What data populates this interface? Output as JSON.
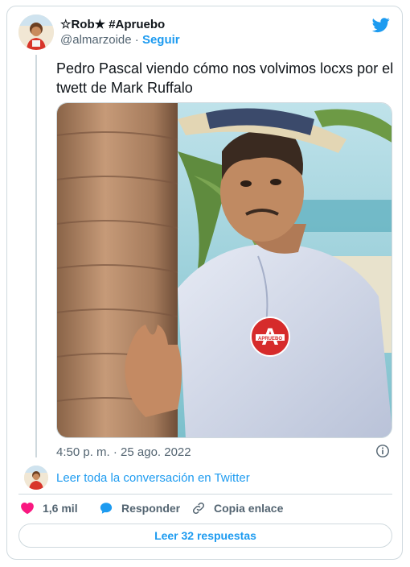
{
  "author": {
    "name": "☆Rob★ #Apruebo",
    "handle": "@almarzoide",
    "separator": "·",
    "follow_label": "Seguir"
  },
  "tweet": {
    "text": "Pedro Pascal viendo cómo nos volvimos locxs por el twett de Mark Ruffalo",
    "badge_text": "APRUEBO",
    "timestamp": "4:50 p. m. · 25 ago. 2022"
  },
  "conversation": {
    "link_label": "Leer toda la conversación en Twitter"
  },
  "actions": {
    "likes": "1,6 mil",
    "reply_label": "Responder",
    "copy_label": "Copia enlace"
  },
  "replies": {
    "button_label": "Leer 32 respuestas"
  },
  "colors": {
    "accent": "#1d9bf0",
    "like": "#f91880",
    "text": "#0f1419",
    "muted": "#536471",
    "border": "#cfd9de"
  },
  "icons": [
    "twitter-bird-icon",
    "info-icon",
    "heart-icon",
    "reply-bubble-icon",
    "link-icon"
  ]
}
